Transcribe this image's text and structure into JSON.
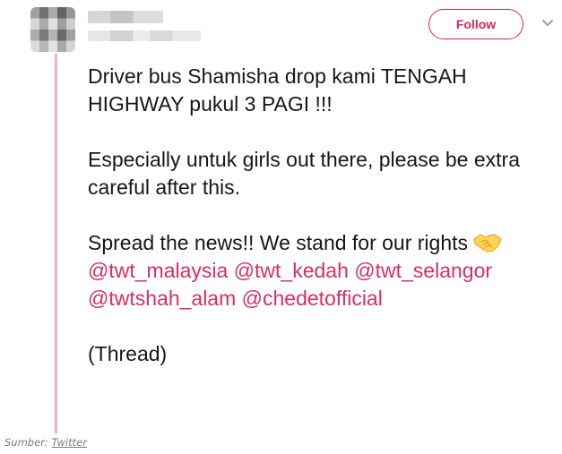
{
  "header": {
    "follow_label": "Follow"
  },
  "tweet": {
    "line1": "Driver bus Shamisha drop kami TENGAH HIGHWAY pukul 3 PAGI !!!",
    "line2": "Especially untuk girls out there, please be extra careful after this.",
    "line3_text": "Spread the news!! We stand for our rights",
    "mentions": [
      "@twt_malaysia",
      "@twt_kedah",
      "@twt_selangor",
      "@twtshah_alam",
      "@chedetofficial"
    ],
    "line4": "(Thread)",
    "emoji": "handshake-icon"
  },
  "source": {
    "prefix": "Sumber:",
    "link": "Twitter"
  },
  "colors": {
    "accent": "#e0245e",
    "mention": "#d82e63",
    "thread_line": "#f5aec3"
  }
}
